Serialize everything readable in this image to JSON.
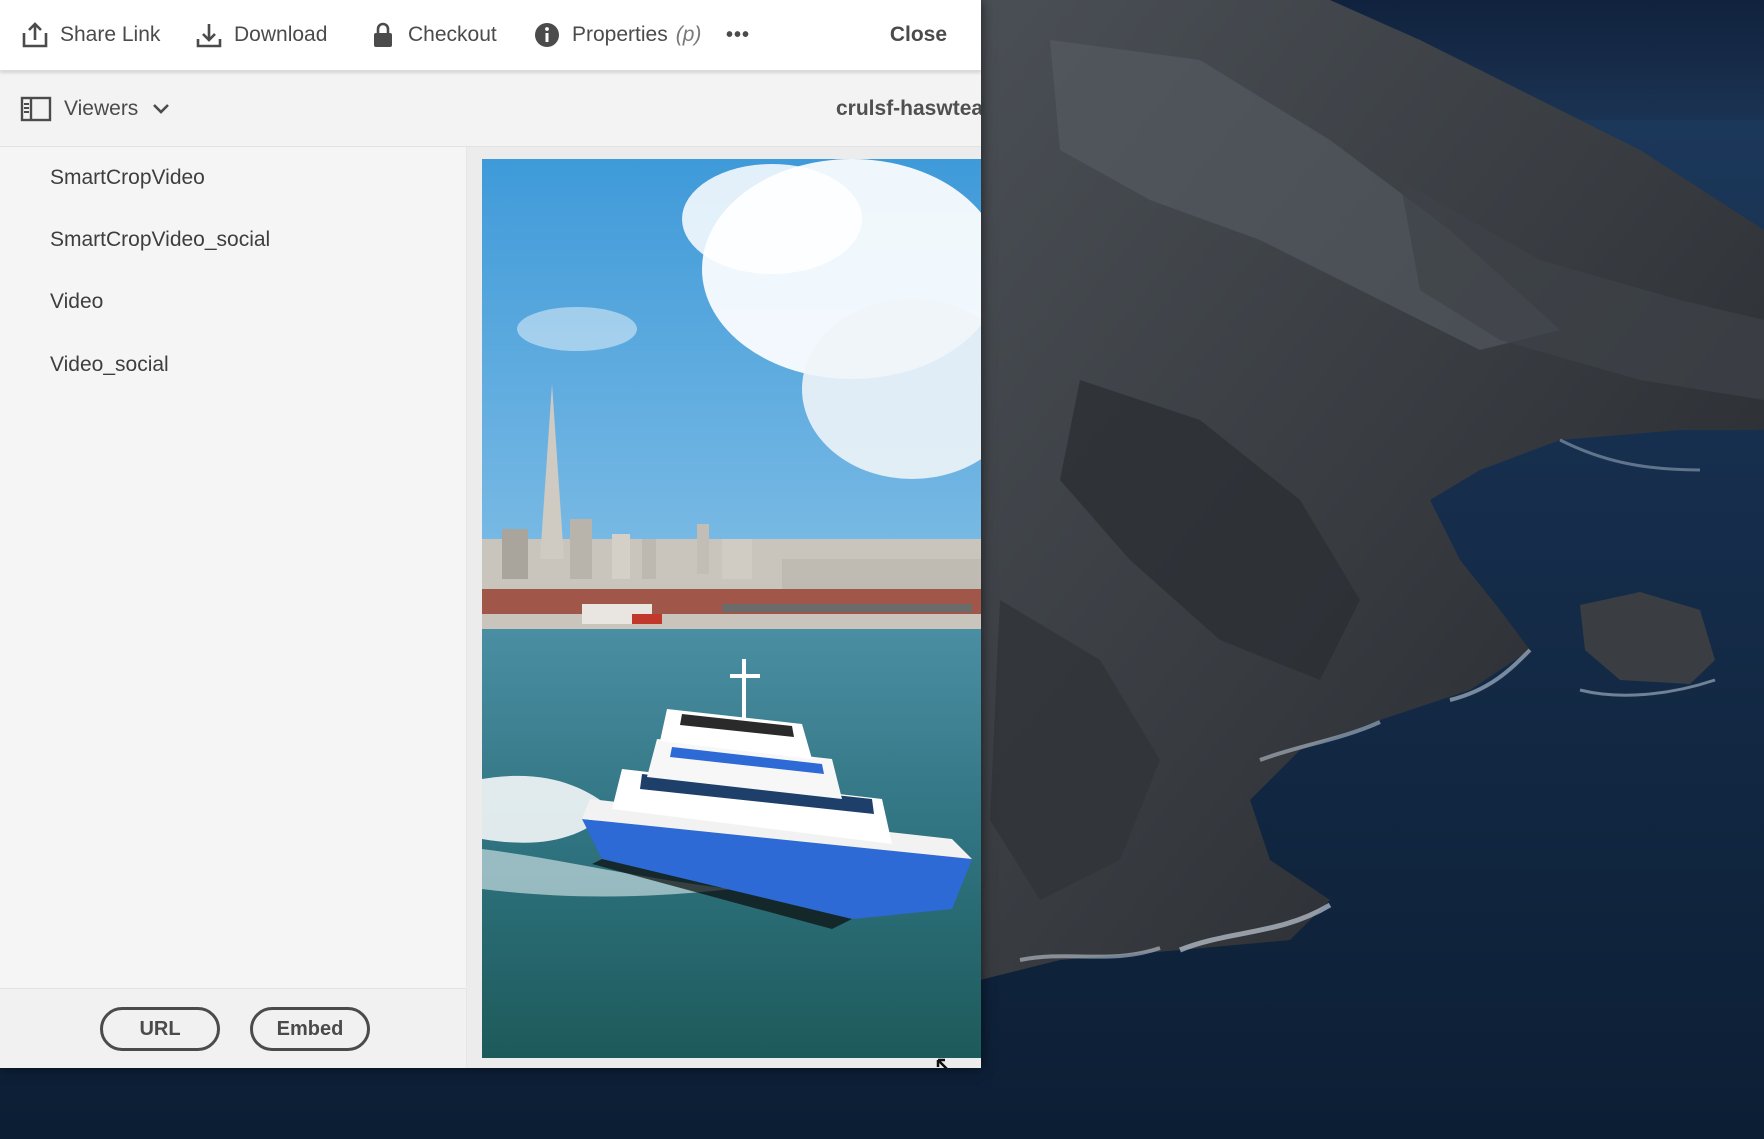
{
  "toolbar": {
    "share_link": "Share Link",
    "download": "Download",
    "checkout": "Checkout",
    "properties": "Properties",
    "properties_hint": "(p)",
    "more": "•••",
    "close": "Close"
  },
  "subbar": {
    "viewers_label": "Viewers",
    "asset_name": "crulsf-haswtea"
  },
  "sidebar": {
    "items": [
      {
        "label": "SmartCropVideo"
      },
      {
        "label": "SmartCropVideo_social"
      },
      {
        "label": "Video"
      },
      {
        "label": "Video_social"
      }
    ]
  },
  "footer": {
    "url_label": "URL",
    "embed_label": "Embed"
  },
  "colors": {
    "toolbar_text": "#4b4b4b",
    "panel_bg": "#f5f5f5",
    "desktop_bg": "#0e1a2c",
    "boat_hull_blue": "#2e6ad6"
  }
}
